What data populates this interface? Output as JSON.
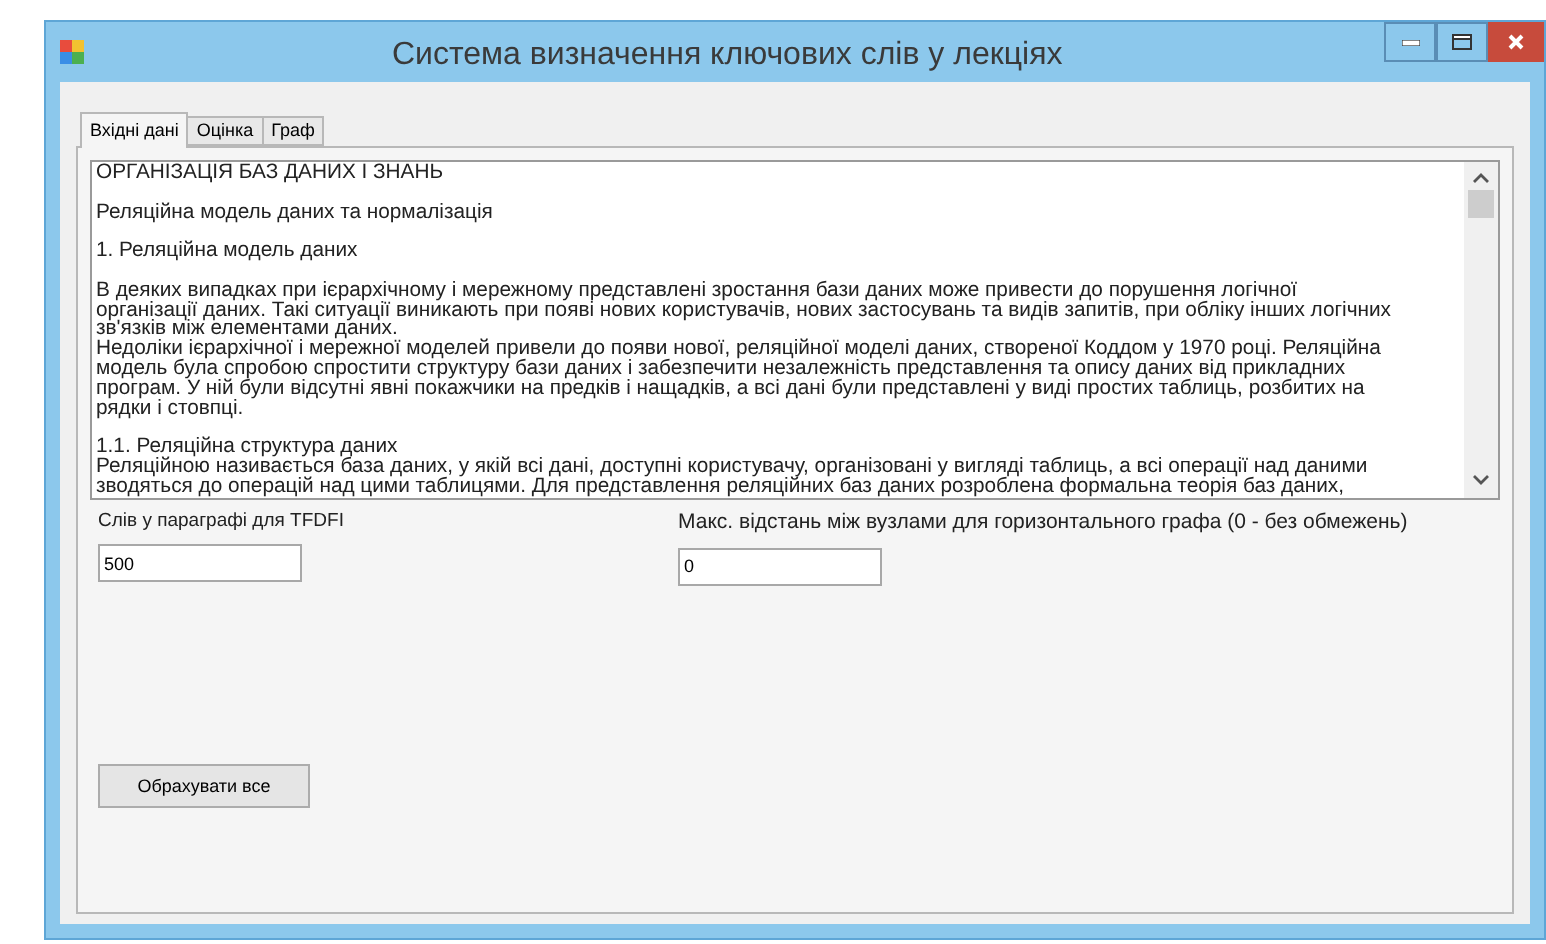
{
  "window": {
    "title": "Система визначення ключових слів у лекціях"
  },
  "tabs": [
    {
      "label": "Вхідні дані",
      "selected": true
    },
    {
      "label": "Оцінка",
      "selected": false
    },
    {
      "label": "Граф",
      "selected": false
    }
  ],
  "text_area": {
    "blocks": [
      {
        "lines": [
          "ОРГАНІЗАЦІЯ БАЗ ДАНИХ І ЗНАНЬ"
        ]
      },
      {
        "lines": [
          "Реляційна модель даних та нормалізація"
        ]
      },
      {
        "lines": [
          "1. Реляційна модель даних"
        ]
      },
      {
        "lines": [
          "В деяких випадках при ієрархічному і мережному представлені зростання бази даних може привести до порушення логічної",
          "організації даних. Такі ситуації виникають при появі нових користувачів, нових застосувань та видів запитів, при обліку інших логічних",
          "зв'язків між елементами даних.",
          "Недоліки ієрархічної і мережної моделей привели до появи нової, реляційної моделі даних, створеної Коддом у 1970 році. Реляційна",
          "модель була спробою спростити структуру бази даних і забезпечити незалежність представлення та опису даних від прикладних",
          "програм. У ній були відсутні явні покажчики на предків і нащадків, а всі дані були представлені у виді простих таблиць, розбитих на",
          "рядки і стовпці."
        ]
      },
      {
        "lines": [
          "1.1. Реляційна структура даних",
          "Реляційною називається база даних, у якій всі дані, доступні користувачу, організовані у вигляді таблиць, а всі операції над даними",
          "зводяться до операцій над цими таблицями. Для представлення реляційних баз даних розроблена формальна теорія баз даних,"
        ]
      }
    ]
  },
  "fields": [
    {
      "label": "Слів у параграфі для TFDFI",
      "value": "500"
    },
    {
      "label": "Макс. відстань між вузлами для горизонтального графа (0 - без обмежень)",
      "value": "0"
    }
  ],
  "buttons": [
    "Обрахувати все"
  ]
}
